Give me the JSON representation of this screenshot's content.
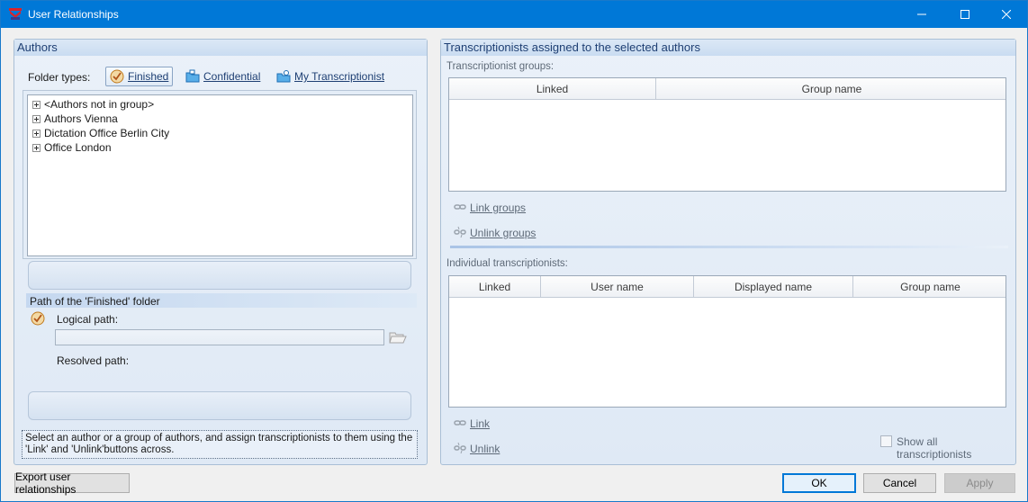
{
  "window": {
    "title": "User Relationships"
  },
  "authors_panel": {
    "header": "Authors",
    "folder_types_label": "Folder types:",
    "folder_types": [
      {
        "label": "Finished",
        "selected": true
      },
      {
        "label": "Confidential",
        "selected": false
      },
      {
        "label": "My Transcriptionist",
        "selected": false
      }
    ],
    "tree": [
      "<Authors not in group>",
      "Authors Vienna",
      "Dictation Office Berlin City",
      "Office London"
    ],
    "path_section": "Path of the 'Finished' folder",
    "logical_path_label": "Logical path:",
    "logical_path_value": "",
    "resolved_path_label": "Resolved path:",
    "hint": "Select an author or a group of authors, and assign transcriptionists to them using the 'Link' and 'Unlink'buttons across."
  },
  "transcriptionists_panel": {
    "header": "Transcriptionists assigned to the selected authors",
    "groups_label": "Transcriptionist groups:",
    "groups_columns": [
      "Linked",
      "Group name"
    ],
    "groups_rows": [],
    "link_groups": "Link groups",
    "unlink_groups": "Unlink groups",
    "individuals_label": "Individual transcriptionists:",
    "individuals_columns": [
      "Linked",
      "User name",
      "Displayed name",
      "Group name"
    ],
    "individuals_rows": [],
    "link": "Link",
    "unlink": "Unlink",
    "show_all_label": "Show all transcriptionists",
    "show_all_checked": false
  },
  "footer": {
    "export": "Export user relationships",
    "ok": "OK",
    "cancel": "Cancel",
    "apply": "Apply"
  }
}
